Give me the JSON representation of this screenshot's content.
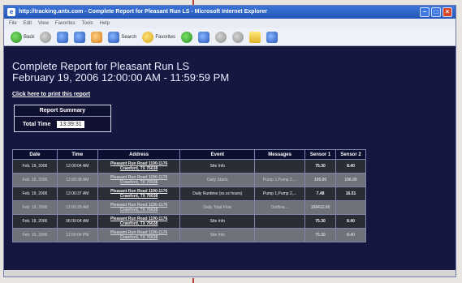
{
  "window": {
    "title": "http://tracking.antx.com - Complete Report for Pleasant Run LS - Microsoft Internet Explorer"
  },
  "menu": [
    "File",
    "Edit",
    "View",
    "Favorites",
    "Tools",
    "Help"
  ],
  "toolbar": {
    "back_label": "Back",
    "search_label": "Search",
    "favorites_label": "Favorites"
  },
  "report": {
    "title": "Complete Report for Pleasant Run LS",
    "date_range": "February 19, 2006 12:00:00 AM - 11:59:59 PM",
    "print_link": "Click here to print this report",
    "summary_header": "Report Summary",
    "total_time_label": "Total Time",
    "total_time_value": "13:39:31"
  },
  "table": {
    "headers": [
      "Date",
      "Time",
      "Address",
      "Event",
      "Messages",
      "Sensor 1",
      "Sensor 2"
    ],
    "rows": [
      {
        "style": "dark",
        "date": "Feb. 19, 2006",
        "time": "12:00:04 AM",
        "address1": "Pleasant Run Road 1190-1176",
        "address2": "Crawford, TX 76638",
        "event": "Site Info",
        "messages": "",
        "sensor1": "75.30",
        "sensor2": "8.40"
      },
      {
        "style": "light",
        "date": "Feb. 19, 2006",
        "time": "12:00:38 AM",
        "address1": "Pleasant Run Road 1190-1176",
        "address2": "Crawford, TX 76638",
        "event": "Daily Starts",
        "messages": "Pump 1,Pump 2,...",
        "sensor1": "195.00",
        "sensor2": "196.00"
      },
      {
        "style": "dark",
        "date": "Feb. 19, 2006",
        "time": "12:00:37 AM",
        "address1": "Pleasant Run Road 1190-1176",
        "address2": "Crawford, TX 76638",
        "event": "Daily Runtime (xx.xx hours)",
        "messages": "Pump 1,Pump 2,...",
        "sensor1": "7.48",
        "sensor2": "16.51"
      },
      {
        "style": "light",
        "date": "Feb. 19, 2006",
        "time": "12:00:39 AM",
        "address1": "Pleasant Run Road 1190-1176",
        "address2": "Crawford, TX 76638",
        "event": "Daily Total Flow",
        "messages": "Outflow,...",
        "sensor1": "158412.00",
        "sensor2": ""
      },
      {
        "style": "dark",
        "date": "Feb. 19, 2006",
        "time": "06:00:04 AM",
        "address1": "Pleasant Run Road 1190-1176",
        "address2": "Crawford, TX 76638",
        "event": "Site Info",
        "messages": "",
        "sensor1": "75.30",
        "sensor2": "8.40"
      },
      {
        "style": "light",
        "date": "Feb. 19, 2006",
        "time": "12:00:04 PM",
        "address1": "Pleasant Run Road 1190-1176",
        "address2": "Crawford, TX 76638",
        "event": "Site Info",
        "messages": "",
        "sensor1": "75.30",
        "sensor2": "8.40"
      }
    ]
  }
}
